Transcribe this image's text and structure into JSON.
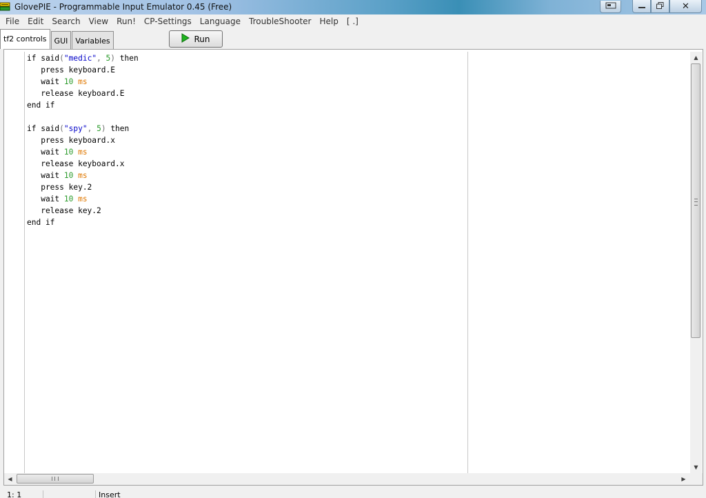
{
  "window": {
    "title": "GlovePIE - Programmable Input Emulator 0.45 (Free)",
    "icons": {
      "app": "glovepie-app-icon",
      "extra": "window-switch-icon",
      "minimize": "minimize-icon",
      "maximize": "restore-icon",
      "close": "close-icon"
    },
    "close_glyph": "✕"
  },
  "menu": {
    "items": [
      "File",
      "Edit",
      "Search",
      "View",
      "Run!",
      "CP-Settings",
      "Language",
      "TroubleShooter",
      "Help",
      "[ .]"
    ]
  },
  "tabs": [
    {
      "label": "tf2 controls",
      "active": true
    },
    {
      "label": "GUI",
      "active": false
    },
    {
      "label": "Variables",
      "active": false
    }
  ],
  "toolbar": {
    "run_label": "Run",
    "run_icon": "play-icon",
    "run_icon_color": "#1db31d"
  },
  "editor": {
    "lines": [
      [
        {
          "t": "if said"
        },
        {
          "t": "(",
          "c": "punc"
        },
        {
          "t": "\"medic\"",
          "c": "str"
        },
        {
          "t": ", ",
          "c": "punc"
        },
        {
          "t": "5",
          "c": "num"
        },
        {
          "t": ")",
          "c": "punc"
        },
        {
          "t": " then"
        }
      ],
      [
        {
          "t": "   press keyboard.E"
        }
      ],
      [
        {
          "t": "   wait "
        },
        {
          "t": "10",
          "c": "num"
        },
        {
          "t": " "
        },
        {
          "t": "ms",
          "c": "unit"
        }
      ],
      [
        {
          "t": "   release keyboard.E"
        }
      ],
      [
        {
          "t": "end if"
        }
      ],
      [
        {
          "t": ""
        }
      ],
      [
        {
          "t": "if said"
        },
        {
          "t": "(",
          "c": "punc"
        },
        {
          "t": "\"spy\"",
          "c": "str"
        },
        {
          "t": ", ",
          "c": "punc"
        },
        {
          "t": "5",
          "c": "num"
        },
        {
          "t": ")",
          "c": "punc"
        },
        {
          "t": " then"
        }
      ],
      [
        {
          "t": "   press keyboard.x"
        }
      ],
      [
        {
          "t": "   wait "
        },
        {
          "t": "10",
          "c": "num"
        },
        {
          "t": " "
        },
        {
          "t": "ms",
          "c": "unit"
        }
      ],
      [
        {
          "t": "   release keyboard.x"
        }
      ],
      [
        {
          "t": "   wait "
        },
        {
          "t": "10",
          "c": "num"
        },
        {
          "t": " "
        },
        {
          "t": "ms",
          "c": "unit"
        }
      ],
      [
        {
          "t": "   press key.2"
        }
      ],
      [
        {
          "t": "   wait "
        },
        {
          "t": "10",
          "c": "num"
        },
        {
          "t": " "
        },
        {
          "t": "ms",
          "c": "unit"
        }
      ],
      [
        {
          "t": "   release key.2"
        }
      ],
      [
        {
          "t": "end if"
        }
      ]
    ],
    "colors": {
      "string": "#0000c8",
      "number": "#2a9a2a",
      "unit": "#e07800",
      "punctuation": "#707070"
    }
  },
  "scrollbars": {
    "vertical": {
      "up_glyph": "▲",
      "down_glyph": "▼",
      "position": 0.0
    },
    "horizontal": {
      "left_glyph": "◀",
      "right_glyph": "▶",
      "position": 0.0
    }
  },
  "status": {
    "position": "1: 1",
    "middle": "",
    "mode": "Insert"
  }
}
